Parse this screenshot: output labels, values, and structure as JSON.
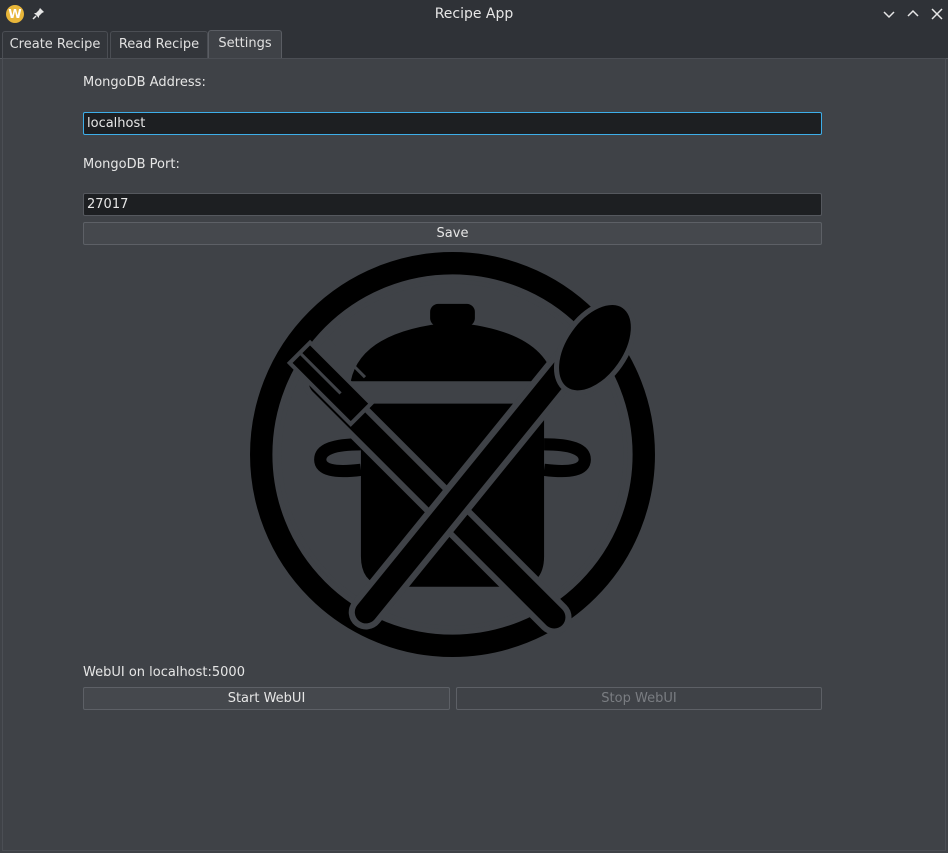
{
  "window": {
    "title": "Recipe App",
    "app_icon_letter": "W"
  },
  "tabs": [
    {
      "label": "Create Recipe",
      "active": false
    },
    {
      "label": "Read Recipe",
      "active": false
    },
    {
      "label": "Settings",
      "active": true
    }
  ],
  "settings": {
    "address_label": "MongoDB Address:",
    "address_value": "localhost",
    "port_label": "MongoDB Port:",
    "port_value": "27017",
    "save_label": "Save",
    "webui_status": "WebUI on localhost:5000",
    "start_label": "Start WebUI",
    "stop_label": "Stop WebUI"
  },
  "icons": {
    "app": "app-w-icon",
    "pin": "pin-icon",
    "minimize": "chevron-down-icon",
    "maximize": "chevron-up-icon",
    "close": "close-icon",
    "logo": "pot-fork-spoon-logo"
  },
  "colors": {
    "accent": "#3daee9",
    "app_icon": "#e8b63a",
    "background": "#3f4247"
  }
}
